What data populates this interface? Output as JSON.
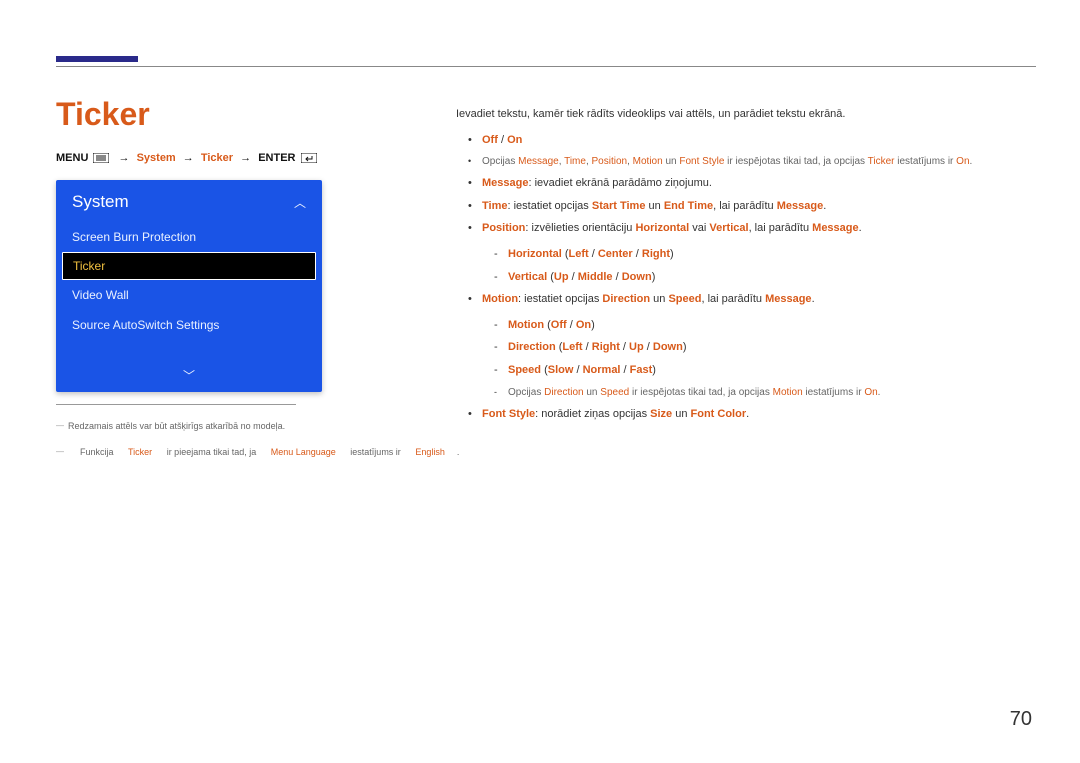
{
  "pageTitle": "Ticker",
  "breadcrumb": {
    "menu": "MENU",
    "path1": "System",
    "path2": "Ticker",
    "enter": "ENTER"
  },
  "panel": {
    "header": "System",
    "items": [
      "Screen Burn Protection",
      "Ticker",
      "Video Wall",
      "Source AutoSwitch Settings"
    ],
    "selectedIndex": 1
  },
  "footnotes": {
    "fn1": "Redzamais attēls var būt atšķirīgs atkarībā no modeļa.",
    "fn2_pre": "Funkcija ",
    "fn2_t1": "Ticker",
    "fn2_mid1": " ir pieejama tikai tad, ja ",
    "fn2_t2": "Menu Language",
    "fn2_mid2": " iestatījums ir ",
    "fn2_t3": "English",
    "fn2_end": "."
  },
  "intro": "Ievadiet tekstu, kamēr tiek rādīts videoklips vai attēls, un parādiet tekstu ekrānā.",
  "b1": {
    "off": "Off",
    "sep": " / ",
    "on": "On"
  },
  "note1": {
    "pre": "Opcijas ",
    "t1": "Message",
    "c1": ", ",
    "t2": "Time",
    "c2": ", ",
    "t3": "Position",
    "c3": ", ",
    "t4": "Motion",
    "c4": " un ",
    "t5": "Font Style",
    "mid": " ir iespējotas tikai tad, ja opcijas ",
    "t6": "Ticker",
    "mid2": " iestatījums ir ",
    "t7": "On",
    "end": "."
  },
  "b2": {
    "label": "Message",
    "text": ": ievadiet ekrānā parādāmo ziņojumu."
  },
  "b3": {
    "label": "Time",
    "pre": ": iestatiet opcijas ",
    "t1": "Start Time",
    "mid": " un ",
    "t2": "End Time",
    "mid2": ", lai parādītu ",
    "t3": "Message",
    "end": "."
  },
  "b4": {
    "label": "Position",
    "pre": ": izvēlieties orientāciju ",
    "t1": "Horizontal",
    "mid": " vai ",
    "t2": "Vertical",
    "mid2": ", lai parādītu ",
    "t3": "Message",
    "end": "."
  },
  "b4s1": {
    "t": "Horizontal",
    "lp": " (",
    "o1": "Left",
    "s": " / ",
    "o2": "Center",
    "o3": "Right",
    "rp": ")"
  },
  "b4s2": {
    "t": "Vertical",
    "lp": " (",
    "o1": "Up",
    "s": " / ",
    "o2": "Middle",
    "o3": "Down",
    "rp": ")"
  },
  "b5": {
    "label": "Motion",
    "pre": ": iestatiet opcijas ",
    "t1": "Direction",
    "mid": " un ",
    "t2": "Speed",
    "mid2": ", lai parādītu ",
    "t3": "Message",
    "end": "."
  },
  "b5s1": {
    "t": "Motion",
    "lp": " (",
    "o1": "Off",
    "s": " / ",
    "o2": "On",
    "rp": ")"
  },
  "b5s2": {
    "t": "Direction",
    "lp": " (",
    "o1": "Left",
    "s": " / ",
    "o2": "Right",
    "o3": "Up",
    "o4": "Down",
    "rp": ")"
  },
  "b5s3": {
    "t": "Speed",
    "lp": " (",
    "o1": "Slow",
    "s": " / ",
    "o2": "Normal",
    "o3": "Fast",
    "rp": ")"
  },
  "note2": {
    "pre": "Opcijas ",
    "t1": "Direction",
    "mid": " un ",
    "t2": "Speed",
    "mid2": " ir iespējotas tikai tad, ja opcijas ",
    "t3": "Motion",
    "mid3": " iestatījums ir ",
    "t4": "On",
    "end": "."
  },
  "b6": {
    "label": "Font Style",
    "pre": ": norādiet ziņas opcijas ",
    "t1": "Size",
    "mid": " un ",
    "t2": "Font Color",
    "end": "."
  },
  "pageNumber": "70"
}
